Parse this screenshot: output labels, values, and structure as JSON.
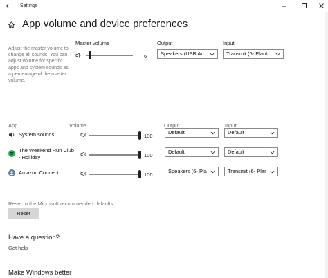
{
  "window": {
    "title": "Settings"
  },
  "header": {
    "title": "App volume and device preferences"
  },
  "master": {
    "description": "Adjust the master volume to change all sounds. You can adjust volume for specific apps and system sounds as a percentage of the master volume.",
    "volume_label": "Master volume",
    "volume_value": "6",
    "volume_level": 0.06,
    "output_label": "Output",
    "output_value": "Speakers (USB Au...",
    "input_label": "Input",
    "input_value": "Transmit (6- Plantr..."
  },
  "apps": {
    "header_app": "App",
    "header_volume": "Volume",
    "header_output": "Output",
    "header_input": "Input",
    "rows": [
      {
        "name": "System sounds",
        "icon": "speaker-icon",
        "volume": "100",
        "level": 1.0,
        "output": "Default",
        "input": "Default"
      },
      {
        "name": "The Weekend Run Club - Holliday",
        "icon": "spotify-icon",
        "volume": "100",
        "level": 1.0,
        "output": "Default",
        "input": "Default"
      },
      {
        "name": "Amazon Connect",
        "icon": "amazon-connect-icon",
        "volume": "100",
        "level": 1.0,
        "output": "Speakers (6- Plan",
        "input": "Transmit (6- Plant"
      }
    ]
  },
  "reset": {
    "description": "Reset to the Microsoft recommended defaults.",
    "button_label": "Reset"
  },
  "help": {
    "heading": "Have a question?",
    "link": "Get help"
  },
  "feedback": {
    "heading": "Make Windows better"
  },
  "colors": {
    "accent": "#1f1f1f",
    "spotify": "#1db954",
    "amazon_connect": "#5b7fa6"
  }
}
